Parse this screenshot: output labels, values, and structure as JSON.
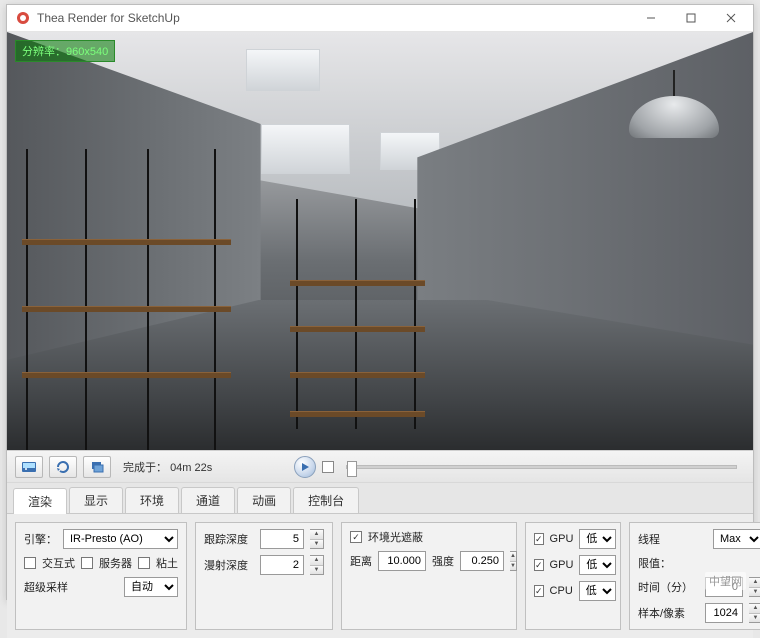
{
  "window": {
    "title": "Thea Render for SketchUp"
  },
  "viewport": {
    "resolution_label": "分辨率：",
    "resolution_value": "960x540"
  },
  "toolbar": {
    "status_prefix": "完成于：",
    "status_time": "04m 22s"
  },
  "tabs": [
    "渲染",
    "显示",
    "环境",
    "通道",
    "动画",
    "控制台"
  ],
  "active_tab_index": 0,
  "engine": {
    "label": "引擎：",
    "value": "IR-Presto (AO)",
    "options": [
      "IR-Presto (AO)"
    ]
  },
  "checks_row": {
    "interactive": "交互式",
    "server": "服务器",
    "clay": "粘土"
  },
  "supersample": {
    "label": "超级采样",
    "value": "自动"
  },
  "trace": {
    "depth_label": "跟踪深度",
    "depth_value": "5",
    "diffuse_label": "漫射深度",
    "diffuse_value": "2"
  },
  "ao": {
    "enable_label": "环境光遮蔽",
    "distance_label": "距离",
    "distance_value": "10.000",
    "intensity_label": "强度",
    "intensity_value": "0.250"
  },
  "devices": {
    "items": [
      {
        "check": true,
        "type": "GPU",
        "priority": "低"
      },
      {
        "check": true,
        "type": "GPU",
        "priority": "低"
      },
      {
        "check": true,
        "type": "CPU",
        "priority": "低"
      }
    ]
  },
  "limits": {
    "threads_label": "线程",
    "threads_value": "Max",
    "limit_label": "限值：",
    "time_label": "时间（分）",
    "time_value": "0",
    "samples_label": "样本/像素",
    "samples_value": "1024"
  },
  "watermark": "中望网"
}
